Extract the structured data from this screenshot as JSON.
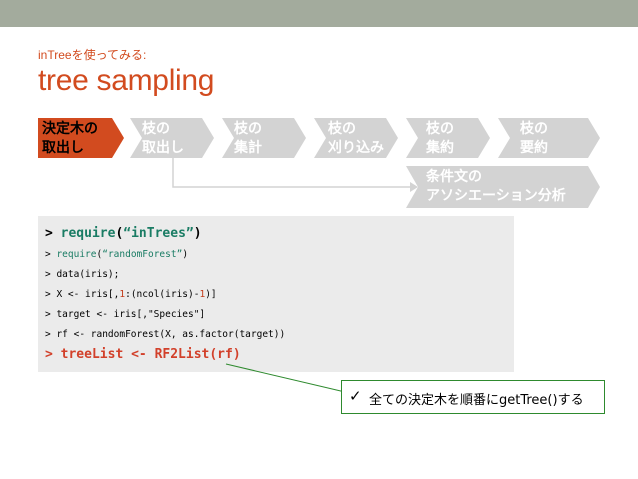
{
  "slide": {
    "subtitle": "inTreeを使ってみる:",
    "title": "tree sampling"
  },
  "steps": [
    {
      "line1": "決定木の",
      "line2": "取出し",
      "active": true
    },
    {
      "line1": "枝の",
      "line2": "取出し",
      "active": false
    },
    {
      "line1": "枝の",
      "line2": "集計",
      "active": false
    },
    {
      "line1": "枝の",
      "line2": "刈り込み",
      "active": false
    },
    {
      "line1": "枝の",
      "line2": "集約",
      "active": false
    },
    {
      "line1": "枝の",
      "line2": "要約",
      "active": false
    }
  ],
  "branch_step": {
    "line1": "条件文の",
    "line2": "アソシエーション分析"
  },
  "colors": {
    "topbar": "#a3ab9d",
    "accent_red": "#d24b1f",
    "step_fill": "#d3d3d3",
    "active_fill": "#d24b1f",
    "code_bg": "#ebebeb",
    "code_green": "#1a7c64",
    "callout_border": "#2e8a2e"
  },
  "code": {
    "line1": {
      "prompt": "> ",
      "fn": "require",
      "open": "(",
      "arg": "“inTrees”",
      "close": ")"
    },
    "line2": {
      "prompt": "> ",
      "fn": "require",
      "open": "(",
      "arg": "“randomForest”",
      "close": ")"
    },
    "line3": "> data(iris);",
    "line4": {
      "a": "> X <- iris[,",
      "n1": "1",
      "b": ":(ncol(iris)-",
      "n2": "1",
      "c": ")]"
    },
    "line5": "> target <- iris[,\"Species\"]",
    "line6": "> rf <- randomForest(X, as.factor(target))",
    "line7": "> treeList <- RF2List(rf)"
  },
  "callout": {
    "icon": "check-icon",
    "check": "✓",
    "text": "全ての決定木を順番にgetTree()する"
  }
}
